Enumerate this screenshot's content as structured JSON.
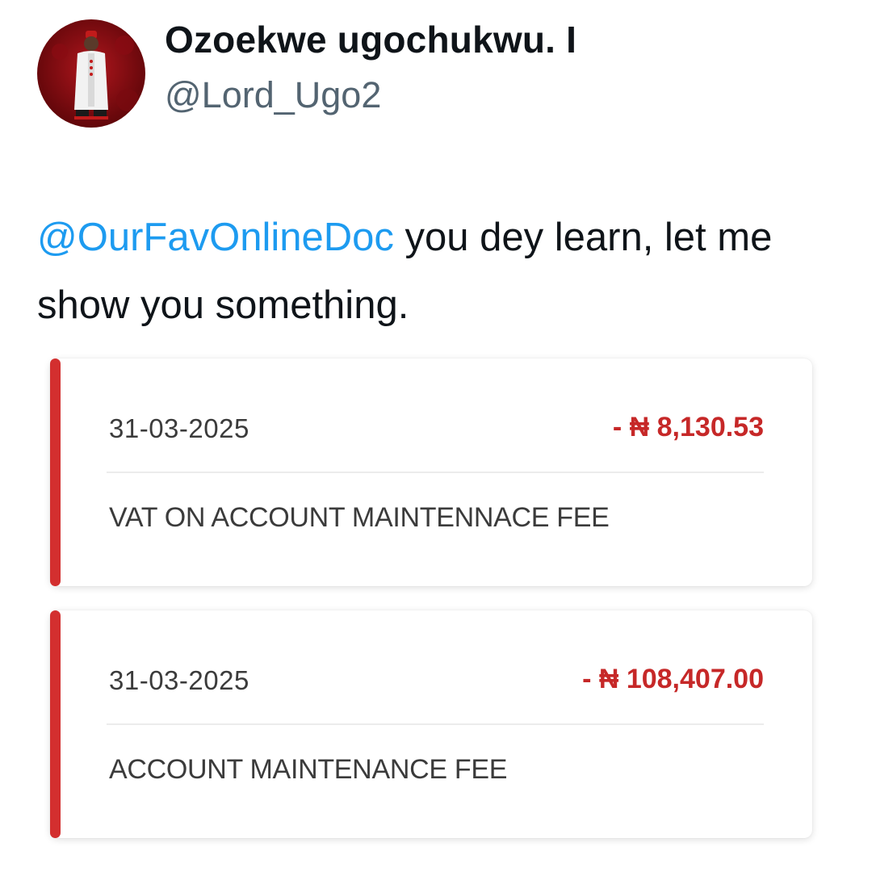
{
  "tweet": {
    "author": {
      "display_name": "Ozoekwe ugochukwu. I",
      "handle": "@Lord_Ugo2"
    },
    "mention": "@OurFavOnlineDoc",
    "text_after_mention": " you dey learn, let me show you something."
  },
  "transactions": [
    {
      "date": "31-03-2025",
      "amount": "- ₦ 8,130.53",
      "description": "VAT ON ACCOUNT MAINTENNACE FEE"
    },
    {
      "date": "31-03-2025",
      "amount": "- ₦ 108,407.00",
      "description": "ACCOUNT MAINTENANCE FEE"
    }
  ],
  "colors": {
    "mention": "#1d9bf0",
    "debit_accent": "#d32f2f",
    "debit_amount": "#c62828"
  }
}
